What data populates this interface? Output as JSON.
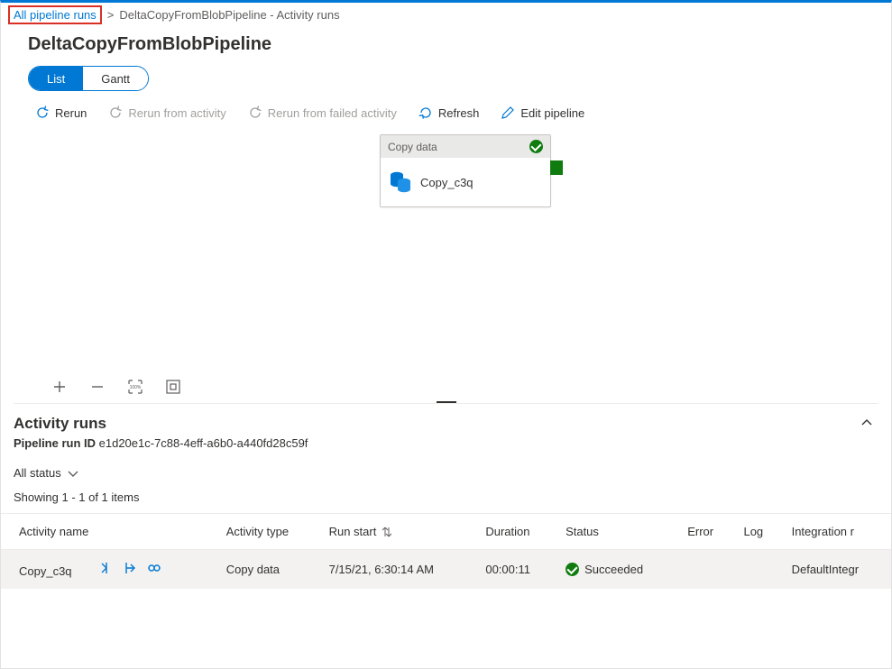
{
  "breadcrumb": {
    "root": "All pipeline runs",
    "current": "DeltaCopyFromBlobPipeline - Activity runs"
  },
  "page_title": "DeltaCopyFromBlobPipeline",
  "view_tabs": {
    "list": "List",
    "gantt": "Gantt"
  },
  "toolbar": {
    "rerun": "Rerun",
    "rerun_activity": "Rerun from activity",
    "rerun_failed": "Rerun from failed activity",
    "refresh": "Refresh",
    "edit": "Edit pipeline"
  },
  "node": {
    "header": "Copy data",
    "name": "Copy_c3q"
  },
  "activity_section": {
    "title": "Activity runs",
    "run_id_label": "Pipeline run ID",
    "run_id": "e1d20e1c-7c88-4eff-a6b0-a440fd28c59f",
    "filter": "All status",
    "showing": "Showing 1 - 1 of 1 items"
  },
  "table": {
    "headers": {
      "name": "Activity name",
      "type": "Activity type",
      "start": "Run start",
      "duration": "Duration",
      "status": "Status",
      "error": "Error",
      "log": "Log",
      "integration": "Integration r"
    },
    "rows": [
      {
        "name": "Copy_c3q",
        "type": "Copy data",
        "start": "7/15/21, 6:30:14 AM",
        "duration": "00:00:11",
        "status": "Succeeded",
        "error": "",
        "log": "",
        "integration": "DefaultIntegr"
      }
    ]
  }
}
